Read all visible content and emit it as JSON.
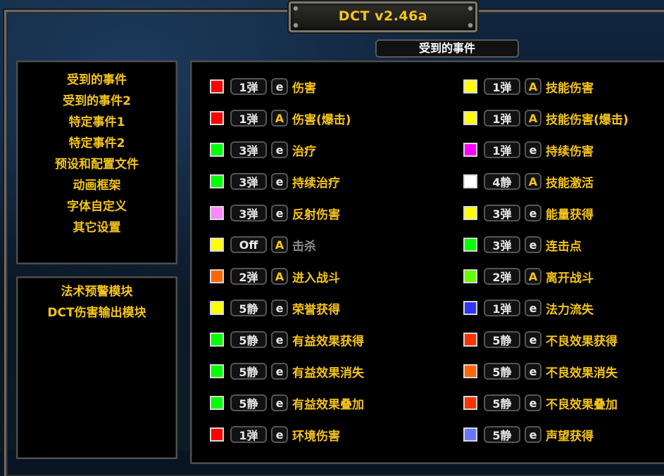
{
  "window": {
    "title": "DCT v2.46a"
  },
  "section_title": "受到的事件",
  "menu": {
    "items": [
      "受到的事件",
      "受到的事件2",
      "特定事件1",
      "特定事件2",
      "预设和配置文件",
      "动画框架",
      "字体自定义",
      "其它设置"
    ],
    "modules": [
      "法术预警模块",
      "DCT伤害输出模块"
    ]
  },
  "events": {
    "left": [
      {
        "color": "#ff0000",
        "mode": "1弹",
        "flag": "e",
        "label": "伤害"
      },
      {
        "color": "#ff0000",
        "mode": "1弹",
        "flag": "A",
        "label": "伤害(爆击)"
      },
      {
        "color": "#00ff00",
        "mode": "3弹",
        "flag": "e",
        "label": "治疗"
      },
      {
        "color": "#00ff00",
        "mode": "3弹",
        "flag": "e",
        "label": "持续治疗"
      },
      {
        "color": "#ff88ff",
        "mode": "3弹",
        "flag": "e",
        "label": "反射伤害"
      },
      {
        "color": "#ffff00",
        "mode": "Off",
        "flag": "A",
        "label": "击杀",
        "dim": true
      },
      {
        "color": "#ff6600",
        "mode": "2弹",
        "flag": "A",
        "label": "进入战斗"
      },
      {
        "color": "#ffff00",
        "mode": "5静",
        "flag": "e",
        "label": "荣誉获得"
      },
      {
        "color": "#00ff00",
        "mode": "5静",
        "flag": "e",
        "label": "有益效果获得"
      },
      {
        "color": "#00ff00",
        "mode": "5静",
        "flag": "e",
        "label": "有益效果消失"
      },
      {
        "color": "#00ff00",
        "mode": "5静",
        "flag": "e",
        "label": "有益效果叠加"
      },
      {
        "color": "#ff0000",
        "mode": "1弹",
        "flag": "e",
        "label": "环境伤害"
      }
    ],
    "right": [
      {
        "color": "#ffff00",
        "mode": "1弹",
        "flag": "A",
        "label": "技能伤害"
      },
      {
        "color": "#ffff00",
        "mode": "1弹",
        "flag": "A",
        "label": "技能伤害(爆击)"
      },
      {
        "color": "#ff00ff",
        "mode": "1弹",
        "flag": "e",
        "label": "持续伤害"
      },
      {
        "color": "#ffffff",
        "mode": "4静",
        "flag": "A",
        "label": "技能激活"
      },
      {
        "color": "#ffff00",
        "mode": "3弹",
        "flag": "e",
        "label": "能量获得"
      },
      {
        "color": "#00ff00",
        "mode": "3弹",
        "flag": "e",
        "label": "连击点"
      },
      {
        "color": "#66ff00",
        "mode": "2弹",
        "flag": "A",
        "label": "离开战斗"
      },
      {
        "color": "#3333ff",
        "mode": "1弹",
        "flag": "e",
        "label": "法力流失"
      },
      {
        "color": "#ff3300",
        "mode": "5静",
        "flag": "e",
        "label": "不良效果获得"
      },
      {
        "color": "#ff6600",
        "mode": "5静",
        "flag": "e",
        "label": "不良效果消失"
      },
      {
        "color": "#ff3300",
        "mode": "5静",
        "flag": "e",
        "label": "不良效果叠加"
      },
      {
        "color": "#6677ff",
        "mode": "5静",
        "flag": "e",
        "label": "声望获得"
      }
    ]
  }
}
